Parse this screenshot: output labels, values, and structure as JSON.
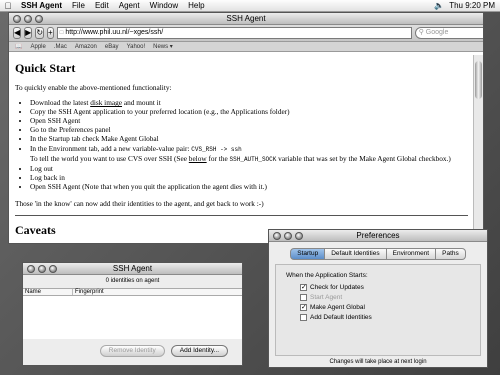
{
  "menubar": {
    "apple_icon": "apple-icon",
    "items": [
      "SSH Agent",
      "File",
      "Edit",
      "Agent",
      "Window",
      "Help"
    ],
    "clock": "Thu 9:20 PM"
  },
  "browser": {
    "title": "SSH Agent",
    "url": "http://www.phil.uu.nl/~xges/ssh/",
    "search_placeholder": "Google",
    "bookmarks": [
      "Apple",
      ".Mac",
      "Amazon",
      "eBay",
      "Yahoo!",
      "News ▾"
    ],
    "heading": "Quick Start",
    "intro": "To quickly enable the above-mentioned functionality:",
    "bullets": {
      "b1_pre": "Download the latest ",
      "b1_link": "disk image",
      "b1_post": " and mount it",
      "b2": "Copy the SSH Agent application to your preferred location (e.g., the Applications folder)",
      "b3": "Open SSH Agent",
      "b4": "Go to the Preferences panel",
      "b5": "In the Startup tab check Make Agent Global",
      "b6_pre": "In the Environment tab, add a new variable-value pair: ",
      "b6_code": "CVS_RSH -> ssh",
      "b6_line2_pre": "To tell the world you want to use CVS over SSH  (See ",
      "b6_link": "below",
      "b6_line2_mid": " for the ",
      "b6_code2": "SSH_AUTH_SOCK",
      "b6_line2_post": " variable that was set by the Make Agent Global checkbox.)",
      "b7": "Log out",
      "b8": "Log back in",
      "b9": "Open SSH Agent (Note that when you quit the application the agent dies with it.)"
    },
    "outro": "Those 'in the know' can now add their identities to the agent, and get back to work :-)",
    "heading2": "Caveats"
  },
  "agent": {
    "title": "SSH Agent",
    "count": "0 identities on agent",
    "col_name": "Name",
    "col_fingerprint": "Fingerprint",
    "remove_button": "Remove Identity",
    "add_button": "Add Identity..."
  },
  "prefs": {
    "title": "Preferences",
    "tabs": [
      "Startup",
      "Default Identities",
      "Environment",
      "Paths"
    ],
    "panel_heading": "When the Application Starts:",
    "options": [
      {
        "label": "Check for Updates",
        "checked": true,
        "enabled": true
      },
      {
        "label": "Start Agent",
        "checked": false,
        "enabled": false
      },
      {
        "label": "Make Agent Global",
        "checked": true,
        "enabled": true
      },
      {
        "label": "Add Default Identities",
        "checked": false,
        "enabled": true
      }
    ],
    "notice": "Changes will take place at next login"
  }
}
